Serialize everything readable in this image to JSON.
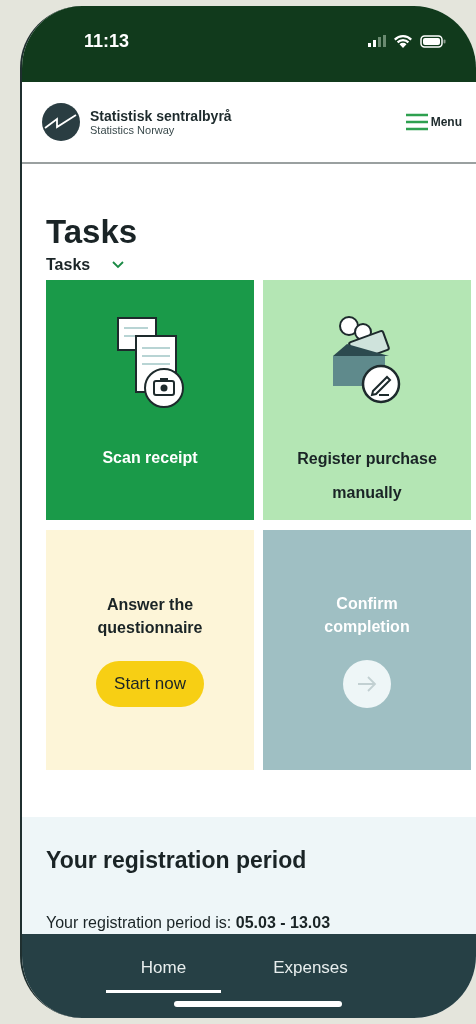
{
  "status_bar": {
    "time": "11:13"
  },
  "header": {
    "org_name": "Statistisk sentralbyrå",
    "org_name_en": "Statistics Norway",
    "menu_label": "Menu"
  },
  "page_title": "Tasks",
  "filter": {
    "label": "Tasks"
  },
  "tasks": [
    {
      "kind": "scan",
      "title": "Scan receipt",
      "disabled": false
    },
    {
      "kind": "manual",
      "title": "Register purchase manually",
      "disabled": false
    },
    {
      "kind": "questionnaire",
      "title": "Answer the questionnaire",
      "button": "Start now",
      "disabled": false
    },
    {
      "kind": "confirm",
      "title": "Confirm completion",
      "disabled": true
    }
  ],
  "registration": {
    "heading": "Your registration period",
    "text": "Your registration period is: **05.03 - 13.03**"
  },
  "nav": [
    {
      "label": "Home",
      "selected": true
    },
    {
      "label": "Expenses",
      "selected": false
    }
  ]
}
